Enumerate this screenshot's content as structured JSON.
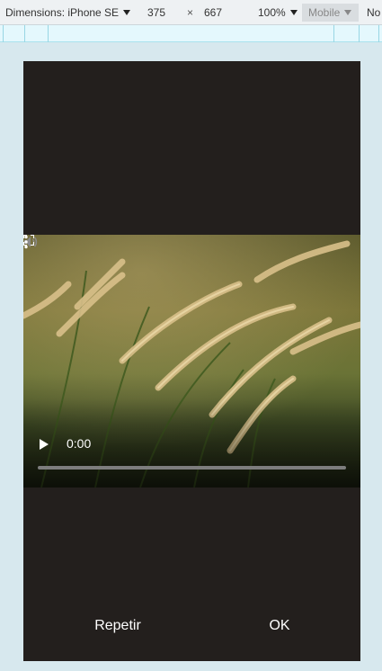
{
  "devtools": {
    "device_label": "Dimensions: iPhone SE",
    "width_value": "375",
    "times_sign": "×",
    "height_value": "667",
    "zoom_label": "100%",
    "mode_label": "Mobile",
    "throttle_label": "No"
  },
  "video": {
    "current_time": "0:00",
    "progress_fraction": 0
  },
  "dialog": {
    "left_button": "Repetir",
    "right_button": "OK"
  },
  "colors": {
    "device_background": "#231f1d",
    "page_background": "#d7e8ee",
    "ruler_background": "#e4f8fd"
  }
}
